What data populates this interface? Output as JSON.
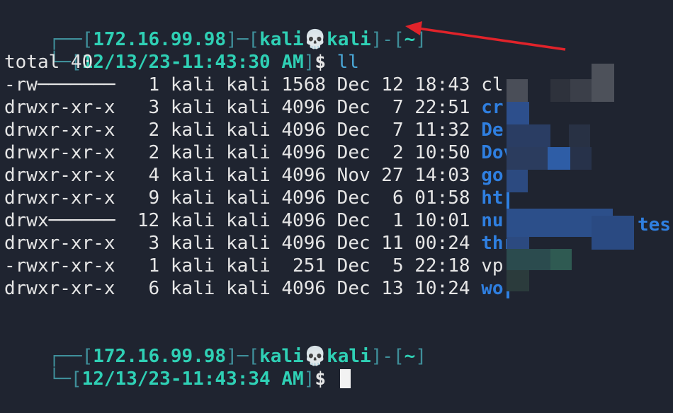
{
  "prompt1": {
    "frame_top_left": "┌──[",
    "ip": "172.16.99.98",
    "sep1": "]─[",
    "user1": "kali",
    "skull": "💀",
    "user2": "kali",
    "sep2": "]-[",
    "dir": "~",
    "end": "]",
    "frame_bottom_left": "└─[",
    "time": "12/13/23-11:43:30 AM",
    "time_end": "]",
    "dollar": "$",
    "command": "ll"
  },
  "total_line": "total 40",
  "listing": [
    {
      "perms": "-rw───────",
      "links": "1",
      "owner": "kali",
      "group": "kali",
      "size": "1568",
      "month": "Dec",
      "day": "12",
      "time": "18:43",
      "name": "cl",
      "is_dir": false
    },
    {
      "perms": "drwxr-xr-x",
      "links": "3",
      "owner": "kali",
      "group": "kali",
      "size": "4096",
      "month": "Dec",
      "day": "7",
      "time": "22:51",
      "name": "cr",
      "is_dir": true
    },
    {
      "perms": "drwxr-xr-x",
      "links": "2",
      "owner": "kali",
      "group": "kali",
      "size": "4096",
      "month": "Dec",
      "day": "7",
      "time": "11:32",
      "name": "De",
      "is_dir": true
    },
    {
      "perms": "drwxr-xr-x",
      "links": "2",
      "owner": "kali",
      "group": "kali",
      "size": "4096",
      "month": "Dec",
      "day": "2",
      "time": "10:50",
      "name": "Dov",
      "is_dir": true
    },
    {
      "perms": "drwxr-xr-x",
      "links": "4",
      "owner": "kali",
      "group": "kali",
      "size": "4096",
      "month": "Nov",
      "day": "27",
      "time": "14:03",
      "name": "go",
      "is_dir": true
    },
    {
      "perms": "drwxr-xr-x",
      "links": "9",
      "owner": "kali",
      "group": "kali",
      "size": "4096",
      "month": "Dec",
      "day": "6",
      "time": "01:58",
      "name": "ht",
      "is_dir": true
    },
    {
      "perms": "drwx──────",
      "links": "12",
      "owner": "kali",
      "group": "kali",
      "size": "4096",
      "month": "Dec",
      "day": "1",
      "time": "10:01",
      "name": "nu",
      "is_dir": true
    },
    {
      "perms": "drwxr-xr-x",
      "links": "3",
      "owner": "kali",
      "group": "kali",
      "size": "4096",
      "month": "Dec",
      "day": "11",
      "time": "00:24",
      "name": "thr",
      "is_dir": true
    },
    {
      "perms": "-rwxr-xr-x",
      "links": "1",
      "owner": "kali",
      "group": "kali",
      "size": "251",
      "month": "Dec",
      "day": "5",
      "time": "22:18",
      "name": "vp",
      "is_dir": false
    },
    {
      "perms": "drwxr-xr-x",
      "links": "6",
      "owner": "kali",
      "group": "kali",
      "size": "4096",
      "month": "Dec",
      "day": "13",
      "time": "10:24",
      "name": "wo",
      "is_dir": true
    }
  ],
  "partial_visible_suffix": "tes",
  "prompt2": {
    "frame_top_left": "┌──[",
    "ip": "172.16.99.98",
    "sep1": "]─[",
    "user1": "kali",
    "skull": "💀",
    "user2": "kali",
    "sep2": "]-[",
    "dir": "~",
    "end": "]",
    "frame_bottom_left": "└─[",
    "time": "12/13/23-11:43:34 AM",
    "time_end": "]",
    "dollar": "$"
  },
  "colors": {
    "background": "#1f2430",
    "prompt_accent": "#2fd0b5",
    "directory": "#2f7fe0",
    "annotation_arrow": "#e0232a"
  }
}
